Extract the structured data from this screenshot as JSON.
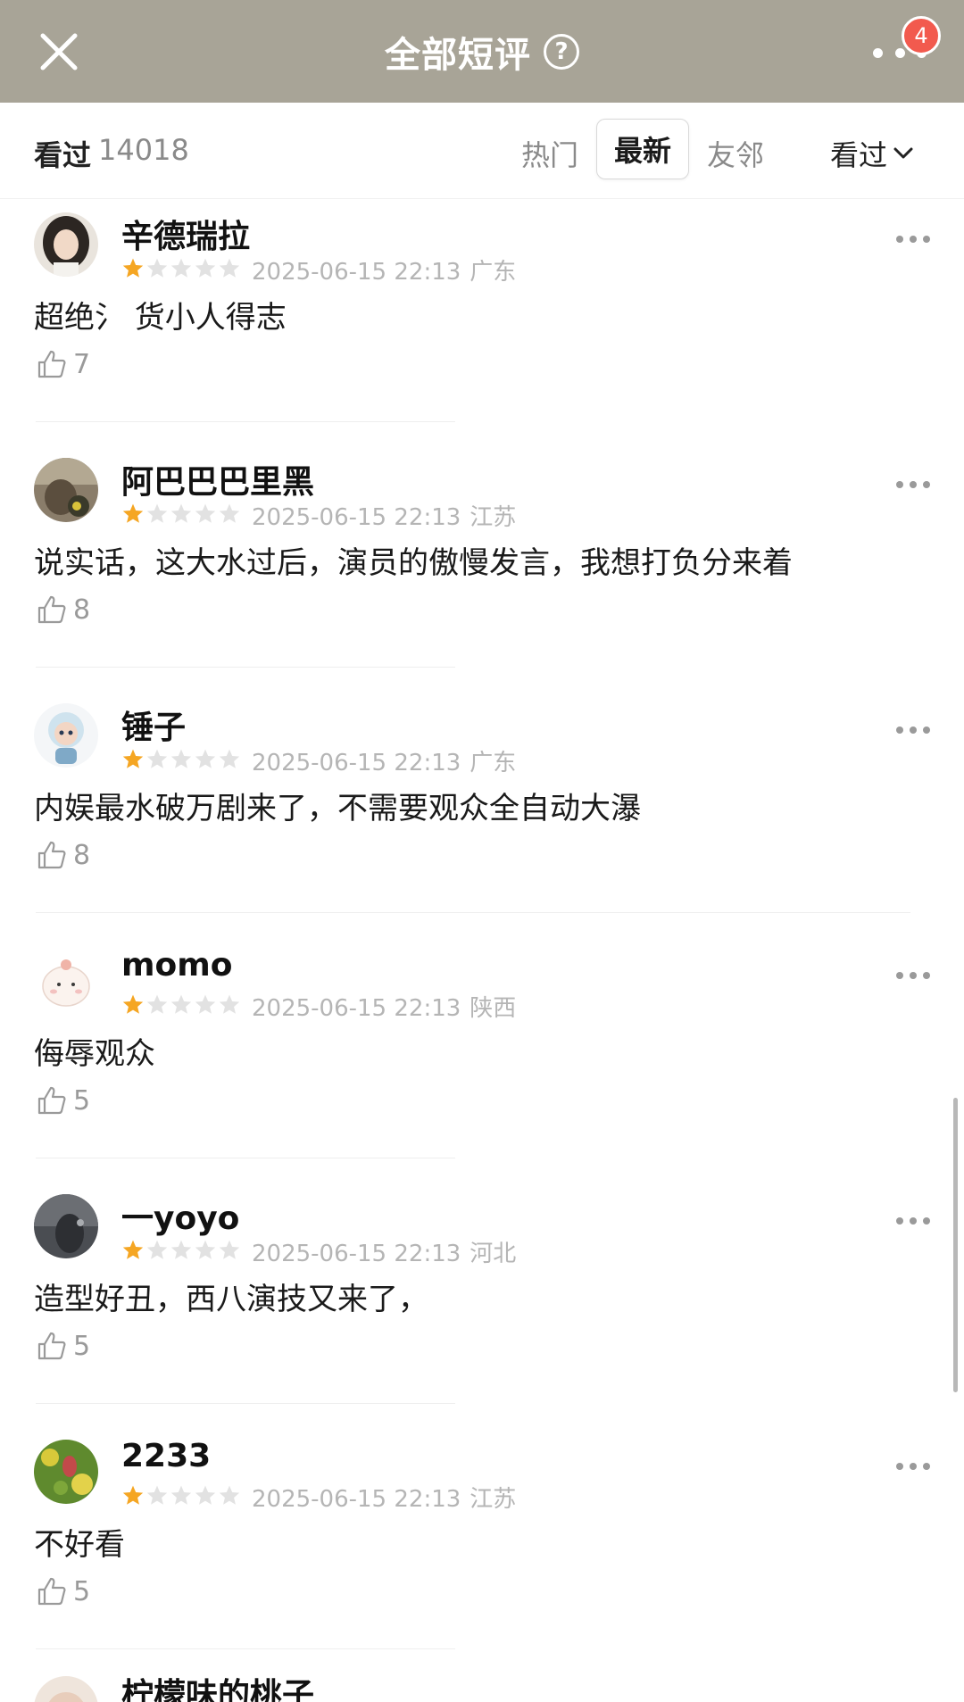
{
  "header": {
    "title": "全部短评",
    "help_icon": "question-circle-icon",
    "close_icon": "close-icon",
    "more_icon": "more-dots-icon",
    "notification_count": "4",
    "background_color": "#a8a497",
    "badge_color": "#f25a4e"
  },
  "filter": {
    "seen_label": "看过",
    "seen_count": "14018",
    "tabs": [
      {
        "label": "热门",
        "active": false
      },
      {
        "label": "最新",
        "active": true
      },
      {
        "label": "友邻",
        "active": false
      }
    ],
    "status_filter": "看过"
  },
  "rating_colors": {
    "filled": "#f5a623",
    "empty": "#e2e2e2"
  },
  "comments": [
    {
      "username": "辛德瑞拉",
      "rating": 1,
      "max_rating": 5,
      "date": "2025-06-15 22:13",
      "location": "广东",
      "content": "超绝氵 货小人得志",
      "likes": "7"
    },
    {
      "username": "阿巴巴巴里黑",
      "rating": 1,
      "max_rating": 5,
      "date": "2025-06-15 22:13",
      "location": "江苏",
      "content": "说实话，这大水过后，演员的傲慢发言，我想打负分来着",
      "likes": "8"
    },
    {
      "username": "锤子",
      "rating": 1,
      "max_rating": 5,
      "date": "2025-06-15 22:13",
      "location": "广东",
      "content": "内娱最水破万剧来了，不需要观众全自动大瀑",
      "likes": "8"
    },
    {
      "username": "momo",
      "rating": 1,
      "max_rating": 5,
      "date": "2025-06-15 22:13",
      "location": "陕西",
      "content": "侮辱观众",
      "likes": "5"
    },
    {
      "username": "一yoyo",
      "rating": 1,
      "max_rating": 5,
      "date": "2025-06-15 22:13",
      "location": "河北",
      "content": "造型好丑，西八演技又来了，",
      "likes": "5"
    },
    {
      "username": "2233",
      "rating": 1,
      "max_rating": 5,
      "date": "2025-06-15 22:13",
      "location": "江苏",
      "content": "不好看",
      "likes": "5"
    }
  ],
  "partial_comment": {
    "username": "柠檬味的桃子"
  }
}
